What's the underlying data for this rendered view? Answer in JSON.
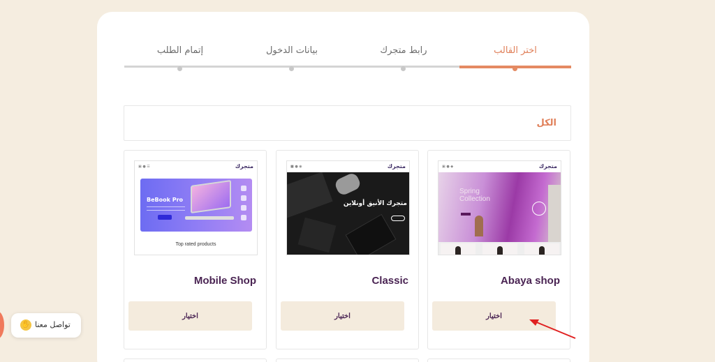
{
  "stepper": {
    "steps": [
      {
        "label": "إتمام الطلب",
        "active": false
      },
      {
        "label": "بيانات الدخول",
        "active": false
      },
      {
        "label": "رابط متجرك",
        "active": false
      },
      {
        "label": "اختر القالب",
        "active": true
      }
    ],
    "accent_color": "#e48a63"
  },
  "filter": {
    "all_label": "الكل"
  },
  "templates": [
    {
      "name": "Mobile Shop",
      "choose_label": "اختيار",
      "preview": {
        "logo": "متجرك",
        "hero_heading": "BeBook Pro",
        "section_caption": "Top rated products"
      }
    },
    {
      "name": "Classic",
      "choose_label": "اختيار",
      "preview": {
        "logo": "متجرك",
        "hero_heading": "متجرك الأنيق أونلاين"
      }
    },
    {
      "name": "Abaya shop",
      "choose_label": "اختيار",
      "preview": {
        "logo": "متجرك",
        "hero_heading": "Spring\nCollection"
      }
    }
  ],
  "chat": {
    "label": "تواصل معنا",
    "icon": "waving-hand-icon"
  },
  "colors": {
    "page_bg": "#f5ede0",
    "title": "#4a2453",
    "button_bg": "#f4ebdd"
  }
}
